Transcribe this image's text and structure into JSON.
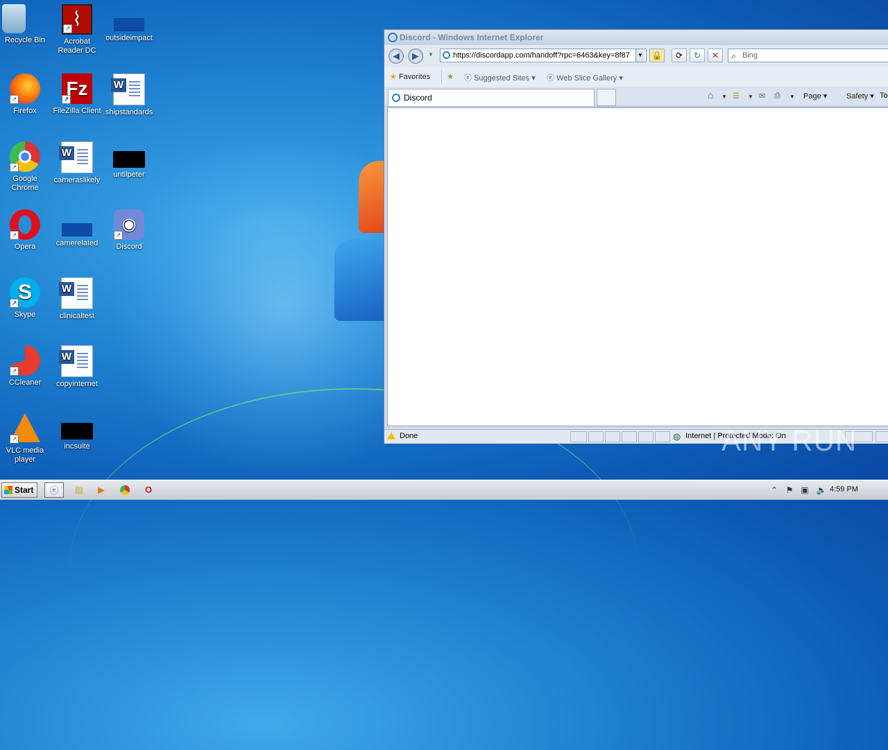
{
  "desktop": {
    "icons": [
      {
        "label": "Recycle Bin"
      },
      {
        "label": "Acrobat Reader DC"
      },
      {
        "label": "outsideimpact"
      },
      {
        "label": "Firefox"
      },
      {
        "label": "FileZilla Client"
      },
      {
        "label": "shipstandards"
      },
      {
        "label": "Google Chrome"
      },
      {
        "label": "cameraslikely"
      },
      {
        "label": "untilpeter"
      },
      {
        "label": "Opera"
      },
      {
        "label": "camerelated"
      },
      {
        "label": "Discord"
      },
      {
        "label": "Skype"
      },
      {
        "label": "clinicaltest"
      },
      {
        "label": "CCleaner"
      },
      {
        "label": "copyinternet"
      },
      {
        "label": "VLC media player"
      },
      {
        "label": "incsuite"
      }
    ]
  },
  "browser": {
    "title": "Discord - Windows Internet Explorer",
    "url": "https://discordapp.com/handoff?rpc=6463&key=8f87",
    "search_placeholder": "Bing",
    "favorites": {
      "favorites_label": "Favorites",
      "suggested_sites": "Suggested Sites",
      "web_slice_gallery": "Web Slice Gallery"
    },
    "tab_label": "Discord",
    "commands": {
      "page": "Page",
      "safety": "Safety",
      "tools": "Tools"
    },
    "status": {
      "text": "Done",
      "zone": "Internet | Protected Mode: On"
    }
  },
  "taskbar": {
    "start_label": "Start",
    "clock": "4:59 PM"
  },
  "watermark": "ANY RUN"
}
